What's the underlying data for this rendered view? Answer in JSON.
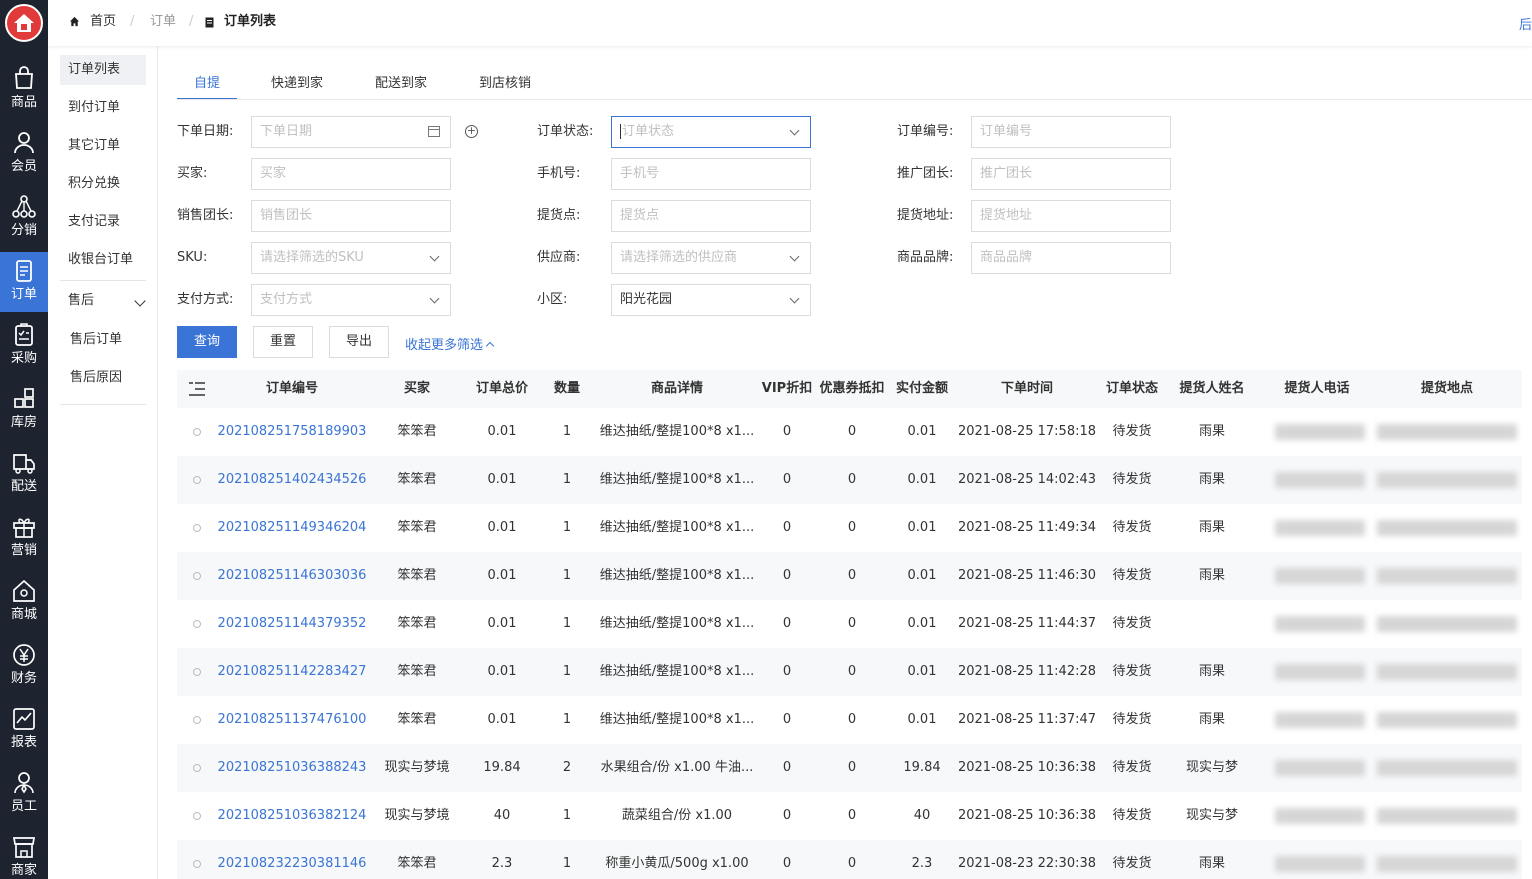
{
  "header": {
    "breadcrumb": [
      "首页",
      "订单",
      "订单列表"
    ],
    "right_text": "后"
  },
  "rail": [
    {
      "label": "商品",
      "icon": "bag-icon"
    },
    {
      "label": "会员",
      "icon": "user-icon"
    },
    {
      "label": "分销",
      "icon": "share-network-icon"
    },
    {
      "label": "订单",
      "icon": "document-icon"
    },
    {
      "label": "采购",
      "icon": "clipboard-icon"
    },
    {
      "label": "库房",
      "icon": "warehouse-icon"
    },
    {
      "label": "配送",
      "icon": "truck-icon"
    },
    {
      "label": "营销",
      "icon": "gift-icon"
    },
    {
      "label": "商城",
      "icon": "home-store-icon"
    },
    {
      "label": "财务",
      "icon": "yen-icon"
    },
    {
      "label": "报表",
      "icon": "chart-icon"
    },
    {
      "label": "员工",
      "icon": "staff-icon"
    },
    {
      "label": "商家",
      "icon": "shop-icon"
    }
  ],
  "submenu": {
    "items": [
      "订单列表",
      "到付订单",
      "其它订单",
      "积分兑换",
      "支付记录",
      "收银台订单"
    ],
    "group": "售后",
    "group_items": [
      "售后订单",
      "售后原因"
    ]
  },
  "tabs": [
    "自提",
    "快递到家",
    "配送到家",
    "到店核销"
  ],
  "filters": {
    "order_date": {
      "label": "下单日期:",
      "placeholder": "下单日期"
    },
    "order_status": {
      "label": "订单状态:",
      "placeholder": "订单状态"
    },
    "order_no": {
      "label": "订单编号:",
      "placeholder": "订单编号"
    },
    "buyer": {
      "label": "买家:",
      "placeholder": "买家"
    },
    "phone": {
      "label": "手机号:",
      "placeholder": "手机号"
    },
    "promoter": {
      "label": "推广团长:",
      "placeholder": "推广团长"
    },
    "sales_leader": {
      "label": "销售团长:",
      "placeholder": "销售团长"
    },
    "pickup_point": {
      "label": "提货点:",
      "placeholder": "提货点"
    },
    "pickup_address": {
      "label": "提货地址:",
      "placeholder": "提货地址"
    },
    "sku": {
      "label": "SKU:",
      "placeholder": "请选择筛选的SKU"
    },
    "supplier": {
      "label": "供应商:",
      "placeholder": "请选择筛选的供应商"
    },
    "brand": {
      "label": "商品品牌:",
      "placeholder": "商品品牌"
    },
    "pay_method": {
      "label": "支付方式:",
      "placeholder": "支付方式"
    },
    "community": {
      "label": "小区:",
      "value": "阳光花园"
    }
  },
  "buttons": {
    "query": "查询",
    "reset": "重置",
    "export": "导出",
    "collapse": "收起更多筛选"
  },
  "table": {
    "columns": [
      "订单编号",
      "买家",
      "订单总价",
      "数量",
      "商品详情",
      "VIP折扣",
      "优惠券抵扣",
      "实付金额",
      "下单时间",
      "订单状态",
      "提货人姓名",
      "提货人电话",
      "提货地点"
    ],
    "rows": [
      {
        "order_no": "202108251758189903",
        "buyer": "笨笨君",
        "total": "0.01",
        "qty": "1",
        "detail": "维达抽纸/整提100*8 x1...",
        "vip": "0",
        "coupon": "0",
        "paid": "0.01",
        "time": "2021-08-25 17:58:18",
        "status": "待发货",
        "name": "雨果"
      },
      {
        "order_no": "202108251402434526",
        "buyer": "笨笨君",
        "total": "0.01",
        "qty": "1",
        "detail": "维达抽纸/整提100*8 x1...",
        "vip": "0",
        "coupon": "0",
        "paid": "0.01",
        "time": "2021-08-25 14:02:43",
        "status": "待发货",
        "name": "雨果"
      },
      {
        "order_no": "202108251149346204",
        "buyer": "笨笨君",
        "total": "0.01",
        "qty": "1",
        "detail": "维达抽纸/整提100*8 x1...",
        "vip": "0",
        "coupon": "0",
        "paid": "0.01",
        "time": "2021-08-25 11:49:34",
        "status": "待发货",
        "name": "雨果"
      },
      {
        "order_no": "202108251146303036",
        "buyer": "笨笨君",
        "total": "0.01",
        "qty": "1",
        "detail": "维达抽纸/整提100*8 x1...",
        "vip": "0",
        "coupon": "0",
        "paid": "0.01",
        "time": "2021-08-25 11:46:30",
        "status": "待发货",
        "name": "雨果"
      },
      {
        "order_no": "202108251144379352",
        "buyer": "笨笨君",
        "total": "0.01",
        "qty": "1",
        "detail": "维达抽纸/整提100*8 x1...",
        "vip": "0",
        "coupon": "0",
        "paid": "0.01",
        "time": "2021-08-25 11:44:37",
        "status": "待发货",
        "name": ""
      },
      {
        "order_no": "202108251142283427",
        "buyer": "笨笨君",
        "total": "0.01",
        "qty": "1",
        "detail": "维达抽纸/整提100*8 x1...",
        "vip": "0",
        "coupon": "0",
        "paid": "0.01",
        "time": "2021-08-25 11:42:28",
        "status": "待发货",
        "name": "雨果"
      },
      {
        "order_no": "202108251137476100",
        "buyer": "笨笨君",
        "total": "0.01",
        "qty": "1",
        "detail": "维达抽纸/整提100*8 x1...",
        "vip": "0",
        "coupon": "0",
        "paid": "0.01",
        "time": "2021-08-25 11:37:47",
        "status": "待发货",
        "name": "雨果"
      },
      {
        "order_no": "202108251036388243",
        "buyer": "现实与梦境",
        "total": "19.84",
        "qty": "2",
        "detail": "水果组合/份 x1.00 牛油...",
        "vip": "0",
        "coupon": "0",
        "paid": "19.84",
        "time": "2021-08-25 10:36:38",
        "status": "待发货",
        "name": "现实与梦"
      },
      {
        "order_no": "202108251036382124",
        "buyer": "现实与梦境",
        "total": "40",
        "qty": "1",
        "detail": "蔬菜组合/份 x1.00",
        "vip": "0",
        "coupon": "0",
        "paid": "40",
        "time": "2021-08-25 10:36:38",
        "status": "待发货",
        "name": "现实与梦"
      },
      {
        "order_no": "202108232230381146",
        "buyer": "笨笨君",
        "total": "2.3",
        "qty": "1",
        "detail": "称重小黄瓜/500g x1.00",
        "vip": "0",
        "coupon": "0",
        "paid": "2.3",
        "time": "2021-08-23 22:30:38",
        "status": "待发货",
        "name": "雨果"
      }
    ]
  },
  "colors": {
    "accent": "#3a74d6",
    "rail_bg": "#1d2430",
    "logo": "#e03a3a"
  }
}
